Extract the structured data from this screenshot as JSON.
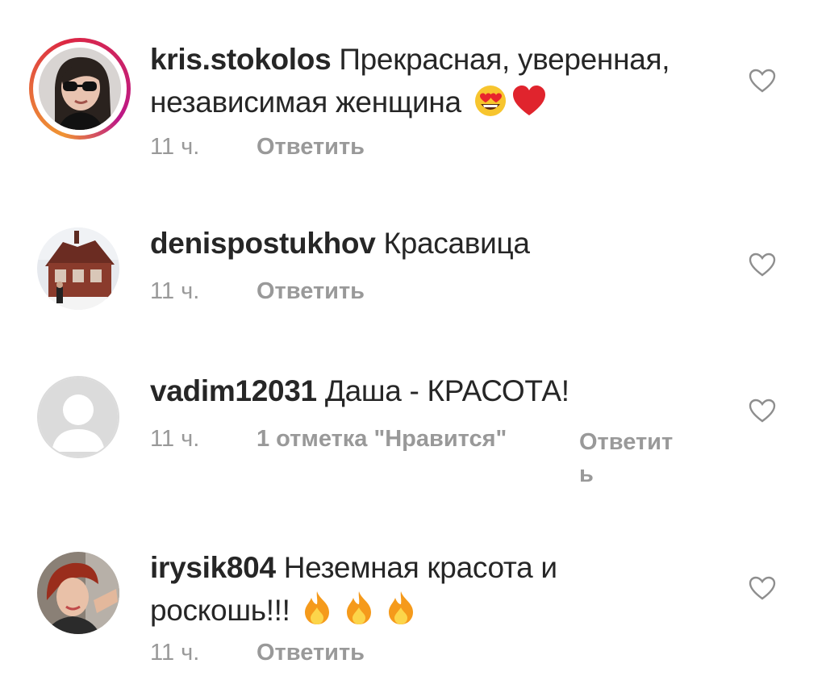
{
  "comments": [
    {
      "username": "kris.stokolos",
      "text": "Прекрасная, уверенная, независимая женщина",
      "emoji": [
        "heart-eyes",
        "red-heart"
      ],
      "time": "11 ч.",
      "reply": "Ответить",
      "avatar": "profile-photo"
    },
    {
      "username": "denispostukhov",
      "text": "Красавица",
      "time": "11 ч.",
      "reply": "Ответить",
      "avatar": "profile-photo"
    },
    {
      "username": "vadim12031",
      "text": "Даша - КРАСОТА!",
      "time": "11 ч.",
      "likes": "1 отметка \"Нравится\"",
      "reply": "Ответить",
      "avatar": "default-avatar"
    },
    {
      "username": "irysik804",
      "text": "Неземная красота и роскошь!!!",
      "emoji": [
        "fire",
        "fire",
        "fire"
      ],
      "time": "11 ч.",
      "reply": "Ответить",
      "avatar": "profile-photo"
    }
  ],
  "colors": {
    "text": "#262626",
    "meta": "#999999",
    "heart_outline": "#8e8e8e",
    "story_ring": "#dc2743"
  },
  "icons": {
    "like": "heart-outline-icon"
  }
}
